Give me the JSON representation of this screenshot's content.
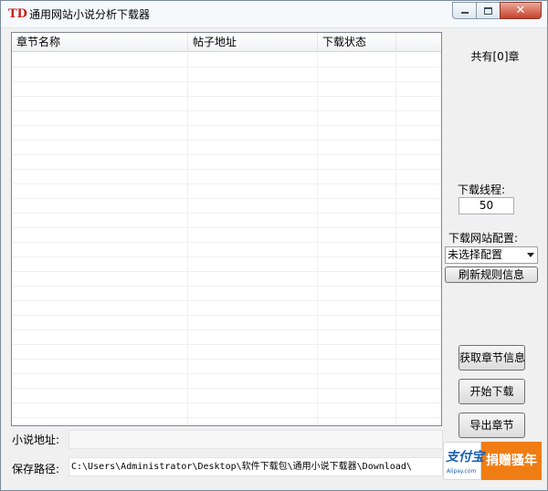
{
  "window": {
    "app_icon": "TD",
    "title": "通用网站小说分析下载器",
    "controls": {
      "minimize_icon": "minimize-icon",
      "maximize_icon": "maximize-icon",
      "close_icon": "close-icon",
      "close_glyph": "✕"
    }
  },
  "chapter_list": {
    "columns": [
      "章节名称",
      "帖子地址",
      "下载状态"
    ],
    "rows": []
  },
  "panel": {
    "chapter_count": "共有[0]章",
    "threads_label": "下载线程:",
    "threads_value": "50",
    "site_config_label": "下载网站配置:",
    "site_config_selected": "未选择配置",
    "refresh_rules_button": "刷新规则信息",
    "fetch_chapters_button": "获取章节信息",
    "start_download_button": "开始下载",
    "export_chapters_button": "导出章节"
  },
  "form": {
    "novel_url_label": "小说地址:",
    "novel_url_value": "",
    "save_path_label": "保存路径:",
    "save_path_value": "C:\\Users\\Administrator\\Desktop\\软件下载包\\通用小说下载器\\Download\\"
  },
  "donate": {
    "alipay_logo": "支付宝",
    "alipay_domain": "Alipay.com",
    "label": "捐赠骚年"
  },
  "colors": {
    "accent_icon": "#c8201c",
    "donate_bg": "#f07d14",
    "alipay_blue": "#1a5fb4"
  }
}
